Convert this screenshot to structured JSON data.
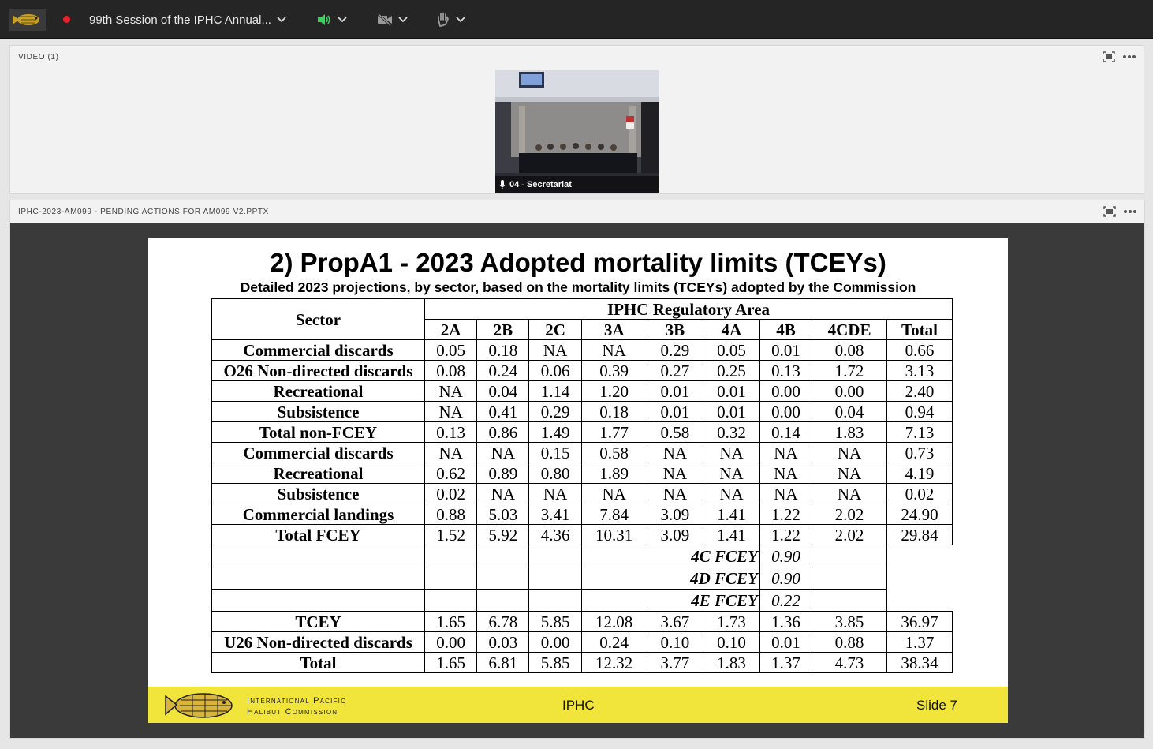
{
  "app": {
    "meeting_title": "99th Session of the IPHC Annual...",
    "video_panel_label": "VIDEO (1)",
    "video_caption": "04 - Secretariat",
    "share_panel_label": "IPHC-2023-AM099 - PENDING ACTIONS FOR AM099 V2.PPTX",
    "colors": {
      "topbar": "#252525",
      "audio_green": "#3ecf5c",
      "record_red": "#e8212b",
      "slide_footer": "#f1e43a"
    }
  },
  "slide": {
    "title": "2) PropA1 - 2023 Adopted mortality limits (TCEYs)",
    "subtitle": "Detailed 2023 projections, by sector, based on the mortality limits (TCEYs) adopted by the Commission",
    "table": {
      "sector_header": "Sector",
      "group_header": "IPHC Regulatory Area",
      "columns": [
        "2A",
        "2B",
        "2C",
        "3A",
        "3B",
        "4A",
        "4B",
        "4CDE",
        "Total"
      ],
      "rows": [
        {
          "label": "Commercial discards",
          "values": [
            "0.05",
            "0.18",
            "NA",
            "NA",
            "0.29",
            "0.05",
            "0.01",
            "0.08",
            "0.66"
          ]
        },
        {
          "label": "O26 Non-directed discards",
          "values": [
            "0.08",
            "0.24",
            "0.06",
            "0.39",
            "0.27",
            "0.25",
            "0.13",
            "1.72",
            "3.13"
          ]
        },
        {
          "label": "Recreational",
          "values": [
            "NA",
            "0.04",
            "1.14",
            "1.20",
            "0.01",
            "0.01",
            "0.00",
            "0.00",
            "2.40"
          ]
        },
        {
          "label": "Subsistence",
          "values": [
            "NA",
            "0.41",
            "0.29",
            "0.18",
            "0.01",
            "0.01",
            "0.00",
            "0.04",
            "0.94"
          ]
        },
        {
          "label": "Total non-FCEY",
          "values": [
            "0.13",
            "0.86",
            "1.49",
            "1.77",
            "0.58",
            "0.32",
            "0.14",
            "1.83",
            "7.13"
          ]
        },
        {
          "label": "Commercial discards",
          "values": [
            "NA",
            "NA",
            "0.15",
            "0.58",
            "NA",
            "NA",
            "NA",
            "NA",
            "0.73"
          ]
        },
        {
          "label": "Recreational",
          "values": [
            "0.62",
            "0.89",
            "0.80",
            "1.89",
            "NA",
            "NA",
            "NA",
            "NA",
            "4.19"
          ]
        },
        {
          "label": "Subsistence",
          "values": [
            "0.02",
            "NA",
            "NA",
            "NA",
            "NA",
            "NA",
            "NA",
            "NA",
            "0.02"
          ]
        },
        {
          "label": "Commercial landings",
          "values": [
            "0.88",
            "5.03",
            "3.41",
            "7.84",
            "3.09",
            "1.41",
            "1.22",
            "2.02",
            "24.90"
          ]
        },
        {
          "label": "Total FCEY",
          "values": [
            "1.52",
            "5.92",
            "4.36",
            "10.31",
            "3.09",
            "1.41",
            "1.22",
            "2.02",
            "29.84"
          ]
        }
      ],
      "fcey_subrows": [
        {
          "label": "4C FCEY",
          "value": "0.90"
        },
        {
          "label": "4D FCEY",
          "value": "0.90"
        },
        {
          "label": "4E FCEY",
          "value": "0.22"
        }
      ],
      "bottom_rows": [
        {
          "label": "TCEY",
          "values": [
            "1.65",
            "6.78",
            "5.85",
            "12.08",
            "3.67",
            "1.73",
            "1.36",
            "3.85",
            "36.97"
          ]
        },
        {
          "label": "U26 Non-directed discards",
          "values": [
            "0.00",
            "0.03",
            "0.00",
            "0.24",
            "0.10",
            "0.10",
            "0.01",
            "0.88",
            "1.37"
          ]
        },
        {
          "label": "Total",
          "values": [
            "1.65",
            "6.81",
            "5.85",
            "12.32",
            "3.77",
            "1.83",
            "1.37",
            "4.73",
            "38.34"
          ]
        }
      ]
    },
    "footer": {
      "org_line1": "International Pacific",
      "org_line2": "Halibut Commission",
      "center": "IPHC",
      "right": "Slide 7"
    }
  }
}
